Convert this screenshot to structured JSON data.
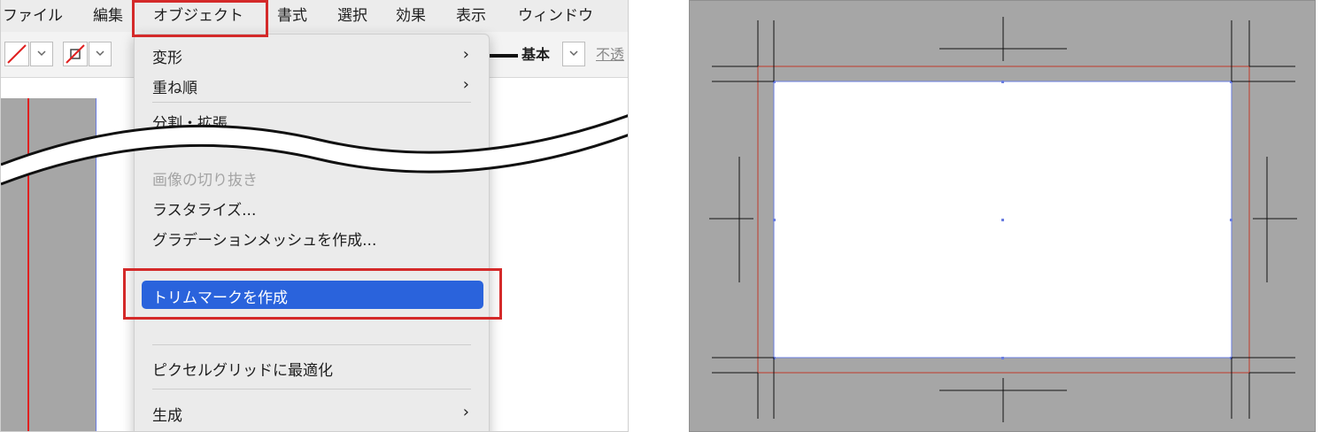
{
  "menubar": {
    "items": [
      "ファイル",
      "編集",
      "オブジェクト",
      "書式",
      "選択",
      "効果",
      "表示",
      "ウィンドウ"
    ]
  },
  "toolbar": {
    "stroke_style_label": "基本",
    "opacity_label": "不透"
  },
  "object_menu": {
    "items": [
      {
        "label": "変形",
        "submenu": true,
        "enabled": true
      },
      {
        "label": "重ね順",
        "submenu": true,
        "enabled": true
      },
      {
        "label": "分割・拡張...",
        "submenu": false,
        "enabled": true
      },
      {
        "label": "画像の切り抜き",
        "submenu": false,
        "enabled": false
      },
      {
        "label": "ラスタライズ...",
        "submenu": false,
        "enabled": true
      },
      {
        "label": "グラデーションメッシュを作成...",
        "submenu": false,
        "enabled": true
      },
      {
        "label": "トリムマークを作成",
        "submenu": false,
        "enabled": true,
        "highlighted": true
      },
      {
        "label": "ピクセルグリッドに最適化",
        "submenu": false,
        "enabled": true
      },
      {
        "label": "生成",
        "submenu": true,
        "enabled": true
      }
    ]
  },
  "colors": {
    "highlight": "#2a63dc",
    "callout": "#d42a2a",
    "artboard_bg": "#a6a6a6",
    "trim_line": "#111111",
    "bleed_line": "#c0392b",
    "selection": "#6a7de0"
  },
  "icons": {
    "stroke_none": "stroke-none-icon",
    "fill_none": "fill-none-icon",
    "chevron": "chevron-right-icon"
  }
}
